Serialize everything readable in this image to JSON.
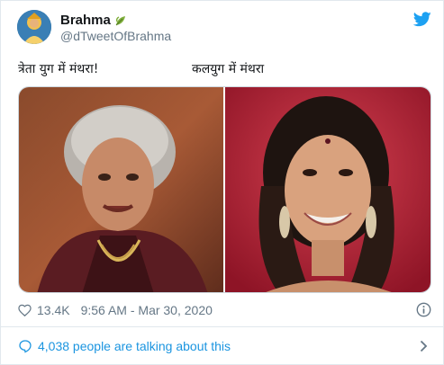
{
  "user": {
    "display_name": "Brahma",
    "handle": "@dTweetOfBrahma",
    "avatar_icon": "avatar-illustration",
    "badge_icon": "leaf-icon"
  },
  "captions": {
    "left": "त्रेता युग में मंथरा!",
    "right": "कलयुग में मंथरा"
  },
  "media": {
    "left_photo": "older woman with grey hair, crying expression, dark red shawl",
    "right_photo": "smiling woman with dark hair, red background"
  },
  "meta": {
    "likes": "13.4K",
    "timestamp": "9:56 AM - Mar 30, 2020"
  },
  "talking": {
    "label": "4,038 people are talking about this"
  },
  "colors": {
    "brand": "#1da1f2",
    "link": "#1b95e0",
    "muted": "#657786",
    "border": "#e1e8ed"
  }
}
